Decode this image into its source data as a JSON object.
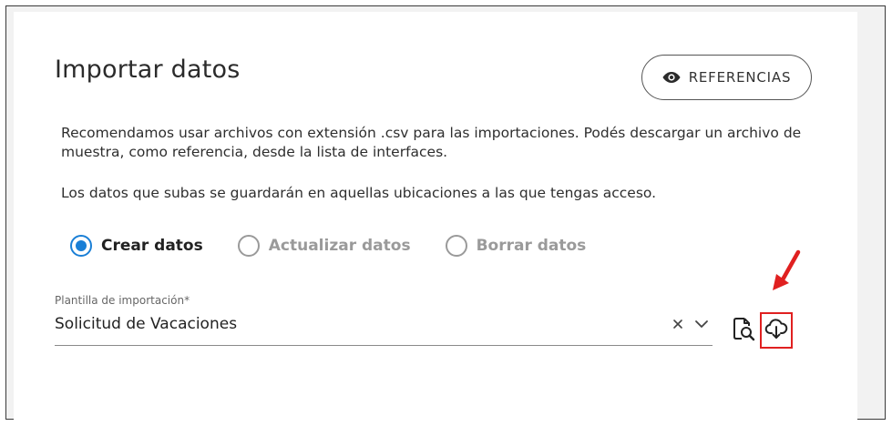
{
  "title": "Importar datos",
  "references_button": {
    "label": "REFERENCIAS",
    "icon": "eye-icon"
  },
  "description": {
    "line1": "Recomendamos usar archivos con extensión .csv para las importaciones. Podés descargar un archivo de muestra, como referencia, desde la lista de interfaces.",
    "line2": "Los datos que subas se guardarán en aquellas ubicaciones a las que tengas acceso."
  },
  "options": [
    {
      "label": "Crear datos",
      "selected": true
    },
    {
      "label": "Actualizar datos",
      "selected": false
    },
    {
      "label": "Borrar datos",
      "selected": false
    }
  ],
  "template_field": {
    "label": "Plantilla de importación*",
    "value": "Solicitud de Vacaciones"
  },
  "actions": {
    "preview_icon": "document-search-icon",
    "download_icon": "cloud-download-icon"
  },
  "colors": {
    "accent": "#1a7fd6",
    "highlight": "#e02020"
  }
}
